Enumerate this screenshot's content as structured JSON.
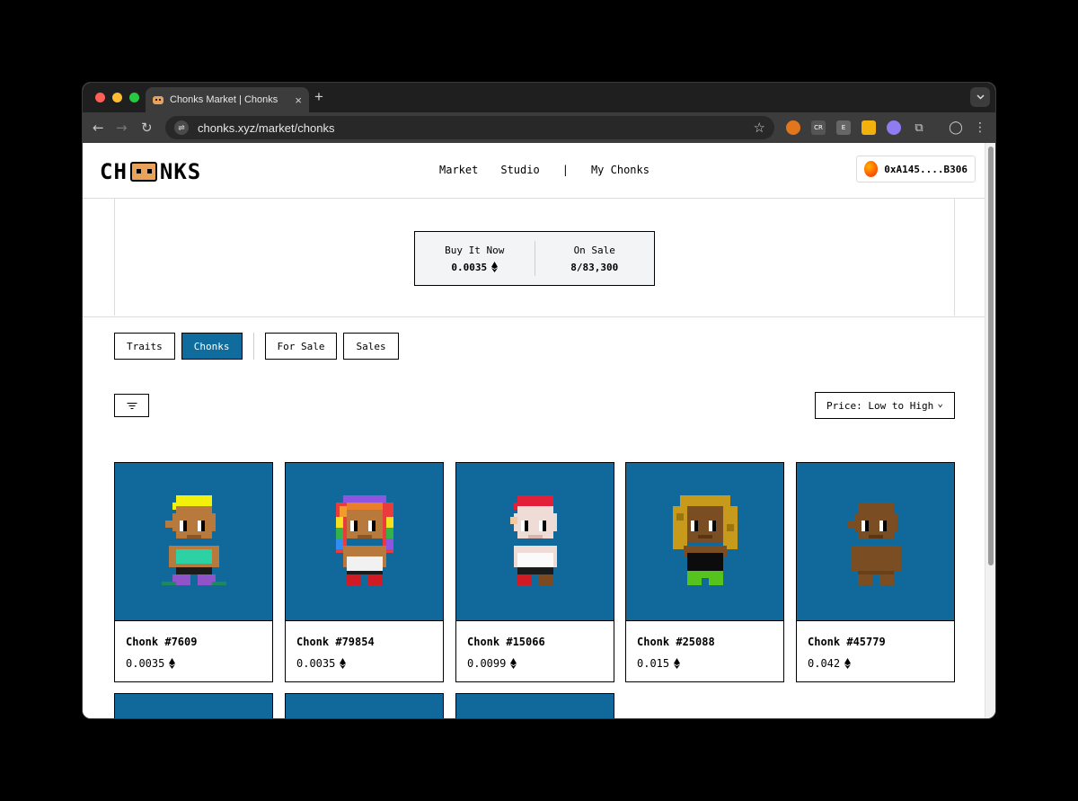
{
  "browser": {
    "tab_title": "Chonks Market | Chonks",
    "tab_close": "×",
    "new_tab": "+",
    "url": "chonks.xyz/market/chonks",
    "site_icon": "⇌",
    "extensions": [
      "CR",
      "E"
    ]
  },
  "header": {
    "logo_left": "CH",
    "logo_right": "NKS",
    "nav": [
      "Market",
      "Studio",
      "|",
      "My Chonks"
    ],
    "wallet": "0xA145....B306"
  },
  "stats": {
    "buy_label": "Buy It Now",
    "buy_value": "0.0035",
    "sale_label": "On Sale",
    "sale_value": "8/83,300"
  },
  "tabs": {
    "traits": "Traits",
    "chonks": "Chonks",
    "for_sale": "For Sale",
    "sales": "Sales"
  },
  "sort": {
    "label": "Price: Low to High",
    "chevron": "⌄"
  },
  "colors": {
    "accent": "#10699a",
    "active_pill": "#0f6c9c"
  },
  "cards": [
    {
      "name": "Chonk #7609",
      "price": "0.0035"
    },
    {
      "name": "Chonk #79854",
      "price": "0.0035"
    },
    {
      "name": "Chonk #15066",
      "price": "0.0099"
    },
    {
      "name": "Chonk #25088",
      "price": "0.015"
    },
    {
      "name": "Chonk #45779",
      "price": "0.042"
    }
  ]
}
